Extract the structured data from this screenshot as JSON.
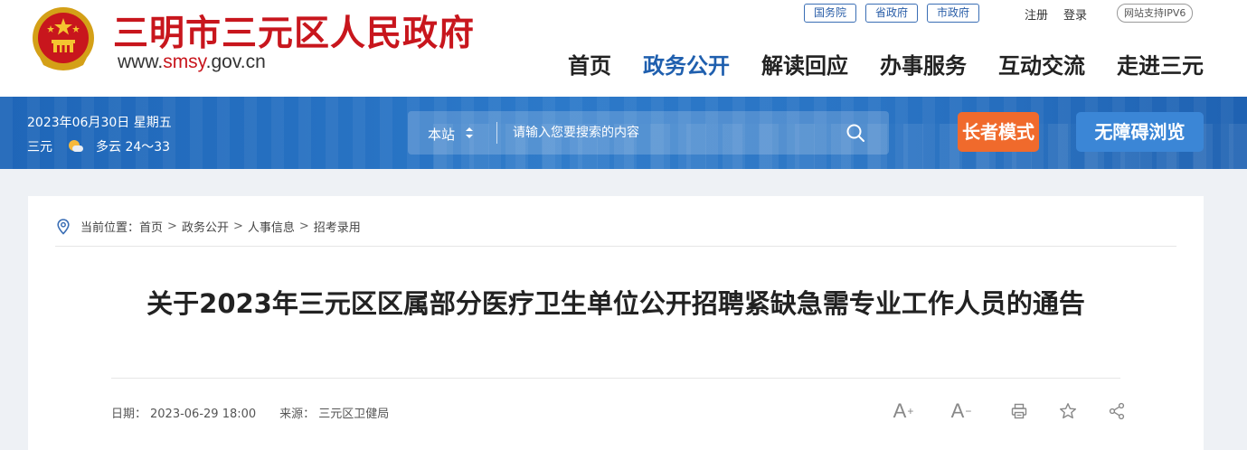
{
  "header": {
    "title": "三明市三元区人民政府",
    "url_prefix": "www.",
    "url_highlight": "smsy",
    "url_suffix": ".gov.cn",
    "top_links": [
      "国务院",
      "省政府",
      "市政府"
    ],
    "register": "注册",
    "login": "登录",
    "ipv6": "网站支持IPV6",
    "nav": [
      "首页",
      "政务公开",
      "解读回应",
      "办事服务",
      "互动交流",
      "走进三元"
    ],
    "nav_active_index": 1,
    "emblem_icon": "national-emblem",
    "colors": {
      "brand_red": "#c8161d",
      "nav_active": "#1f5fae",
      "banner_blue": "#2a74c4",
      "elder_orange": "#f06a2c",
      "access_blue": "#3b86d6"
    }
  },
  "banner": {
    "date": "2023年06月30日 星期五",
    "city": "三元",
    "weather": "多云 24～33",
    "weather_icon": "partly-cloudy-icon",
    "search_scope": "本站",
    "search_placeholder": "请输入您要搜索的内容",
    "elder_mode": "长者模式",
    "accessible_mode": "无障碍浏览"
  },
  "breadcrumb": {
    "label": "当前位置：",
    "items": [
      "首页",
      "政务公开",
      "人事信息",
      "招考录用"
    ],
    "separator": ">"
  },
  "article": {
    "title": "关于2023年三元区区属部分医疗卫生单位公开招聘紧缺急需专业工作人员的通告",
    "date_label": "日期：",
    "date": "2023-06-29 18:00",
    "source_label": "来源：",
    "source": "三元区卫健局",
    "tools": {
      "font_plus": "A",
      "font_plus_sign": "+",
      "font_minus": "A",
      "font_minus_sign": "−"
    }
  }
}
